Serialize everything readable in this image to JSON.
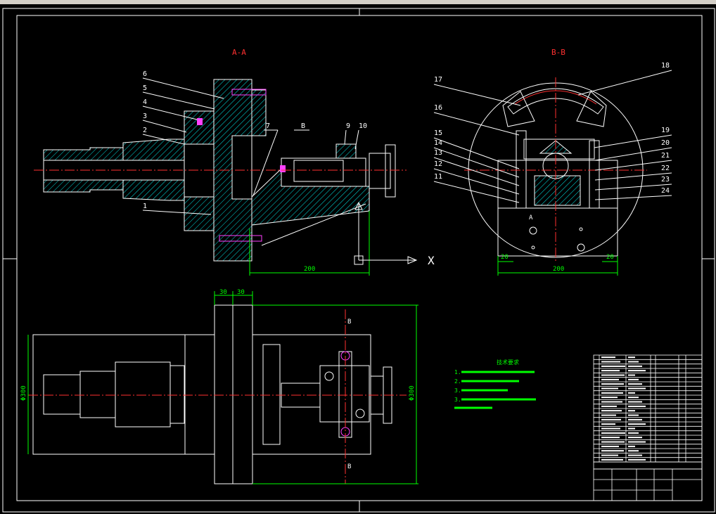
{
  "views": {
    "section_aa": "A-A",
    "section_bb": "B-B",
    "marker_b": "B",
    "marker_a": "A"
  },
  "callouts": {
    "left": [
      "6",
      "5",
      "4",
      "3",
      "2",
      "1",
      "7",
      "9",
      "10"
    ],
    "right_left_side": [
      "17",
      "16",
      "15",
      "14",
      "13",
      "12",
      "11"
    ],
    "right_right_side": [
      "18",
      "19",
      "20",
      "21",
      "22",
      "23",
      "24"
    ]
  },
  "dimensions": {
    "d200_aa": "200",
    "d200_bb": "200",
    "d20_left": "20",
    "d20_right": "20",
    "d30_a": "30",
    "d30_b": "30",
    "dia300_left": "Φ300",
    "dia300_right": "Φ300"
  },
  "axis_label": "X",
  "notes": {
    "title": "技术要求",
    "lines": [
      "1.",
      "2.",
      "3.",
      "3."
    ]
  },
  "colors": {
    "background": "#000000",
    "outline": "#ffffff",
    "centerline": "#ff3030",
    "hatch": "#00e0e0",
    "dimension": "#00ff00",
    "bolt": "#ff40ff",
    "part": "#ffffff"
  }
}
